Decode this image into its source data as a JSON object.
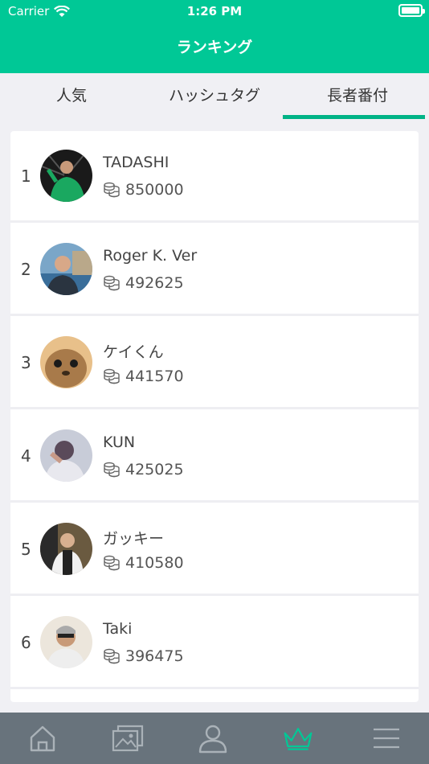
{
  "status_bar": {
    "carrier": "Carrier",
    "time": "1:26 PM"
  },
  "nav": {
    "title": "ランキング"
  },
  "tabs": [
    {
      "label": "人気"
    },
    {
      "label": "ハッシュタグ"
    },
    {
      "label": "長者番付",
      "selected": true
    }
  ],
  "ranking": [
    {
      "rank": "1",
      "name": "TADASHI",
      "coins": "850000"
    },
    {
      "rank": "2",
      "name": "Roger K. Ver",
      "coins": "492625"
    },
    {
      "rank": "3",
      "name": "ケイくん",
      "coins": "441570"
    },
    {
      "rank": "4",
      "name": "KUN",
      "coins": "425025"
    },
    {
      "rank": "5",
      "name": "ガッキー",
      "coins": "410580"
    },
    {
      "rank": "6",
      "name": "Taki",
      "coins": "396475"
    }
  ],
  "tab_bar": {
    "items": [
      "home-icon",
      "gallery-icon",
      "profile-icon",
      "crown-icon",
      "menu-icon"
    ],
    "active": "crown-icon"
  },
  "colors": {
    "brand": "#00c896",
    "tab_accent": "#00b386",
    "tabbar_bg": "#68737c"
  }
}
